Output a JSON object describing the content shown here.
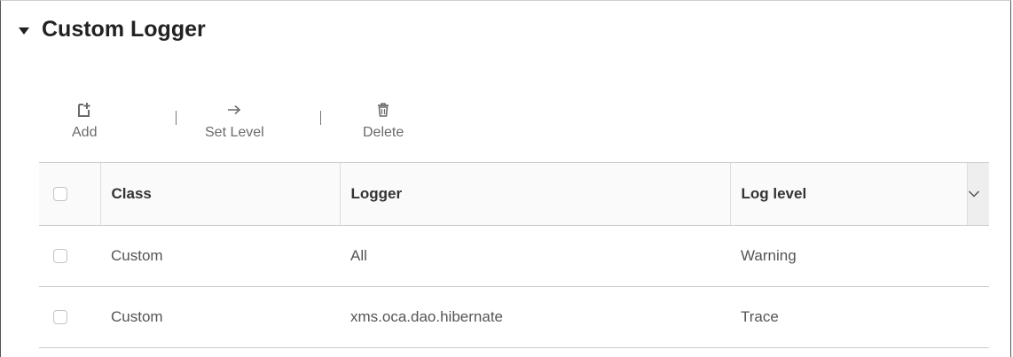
{
  "section": {
    "title": "Custom Logger",
    "caret_icon": "caret-down-icon"
  },
  "toolbar": {
    "add_label": "Add",
    "add_icon": "add-icon",
    "setlevel_label": "Set Level",
    "setlevel_icon": "arrow-right-icon",
    "delete_label": "Delete",
    "delete_icon": "trash-icon"
  },
  "table": {
    "columns": [
      "Class",
      "Logger",
      "Log level"
    ],
    "sort_icon": "chevron-down-icon",
    "rows": [
      {
        "class": "Custom",
        "logger": "All",
        "log_level": "Warning"
      },
      {
        "class": "Custom",
        "logger": "xms.oca.dao.hibernate",
        "log_level": "Trace"
      }
    ]
  }
}
